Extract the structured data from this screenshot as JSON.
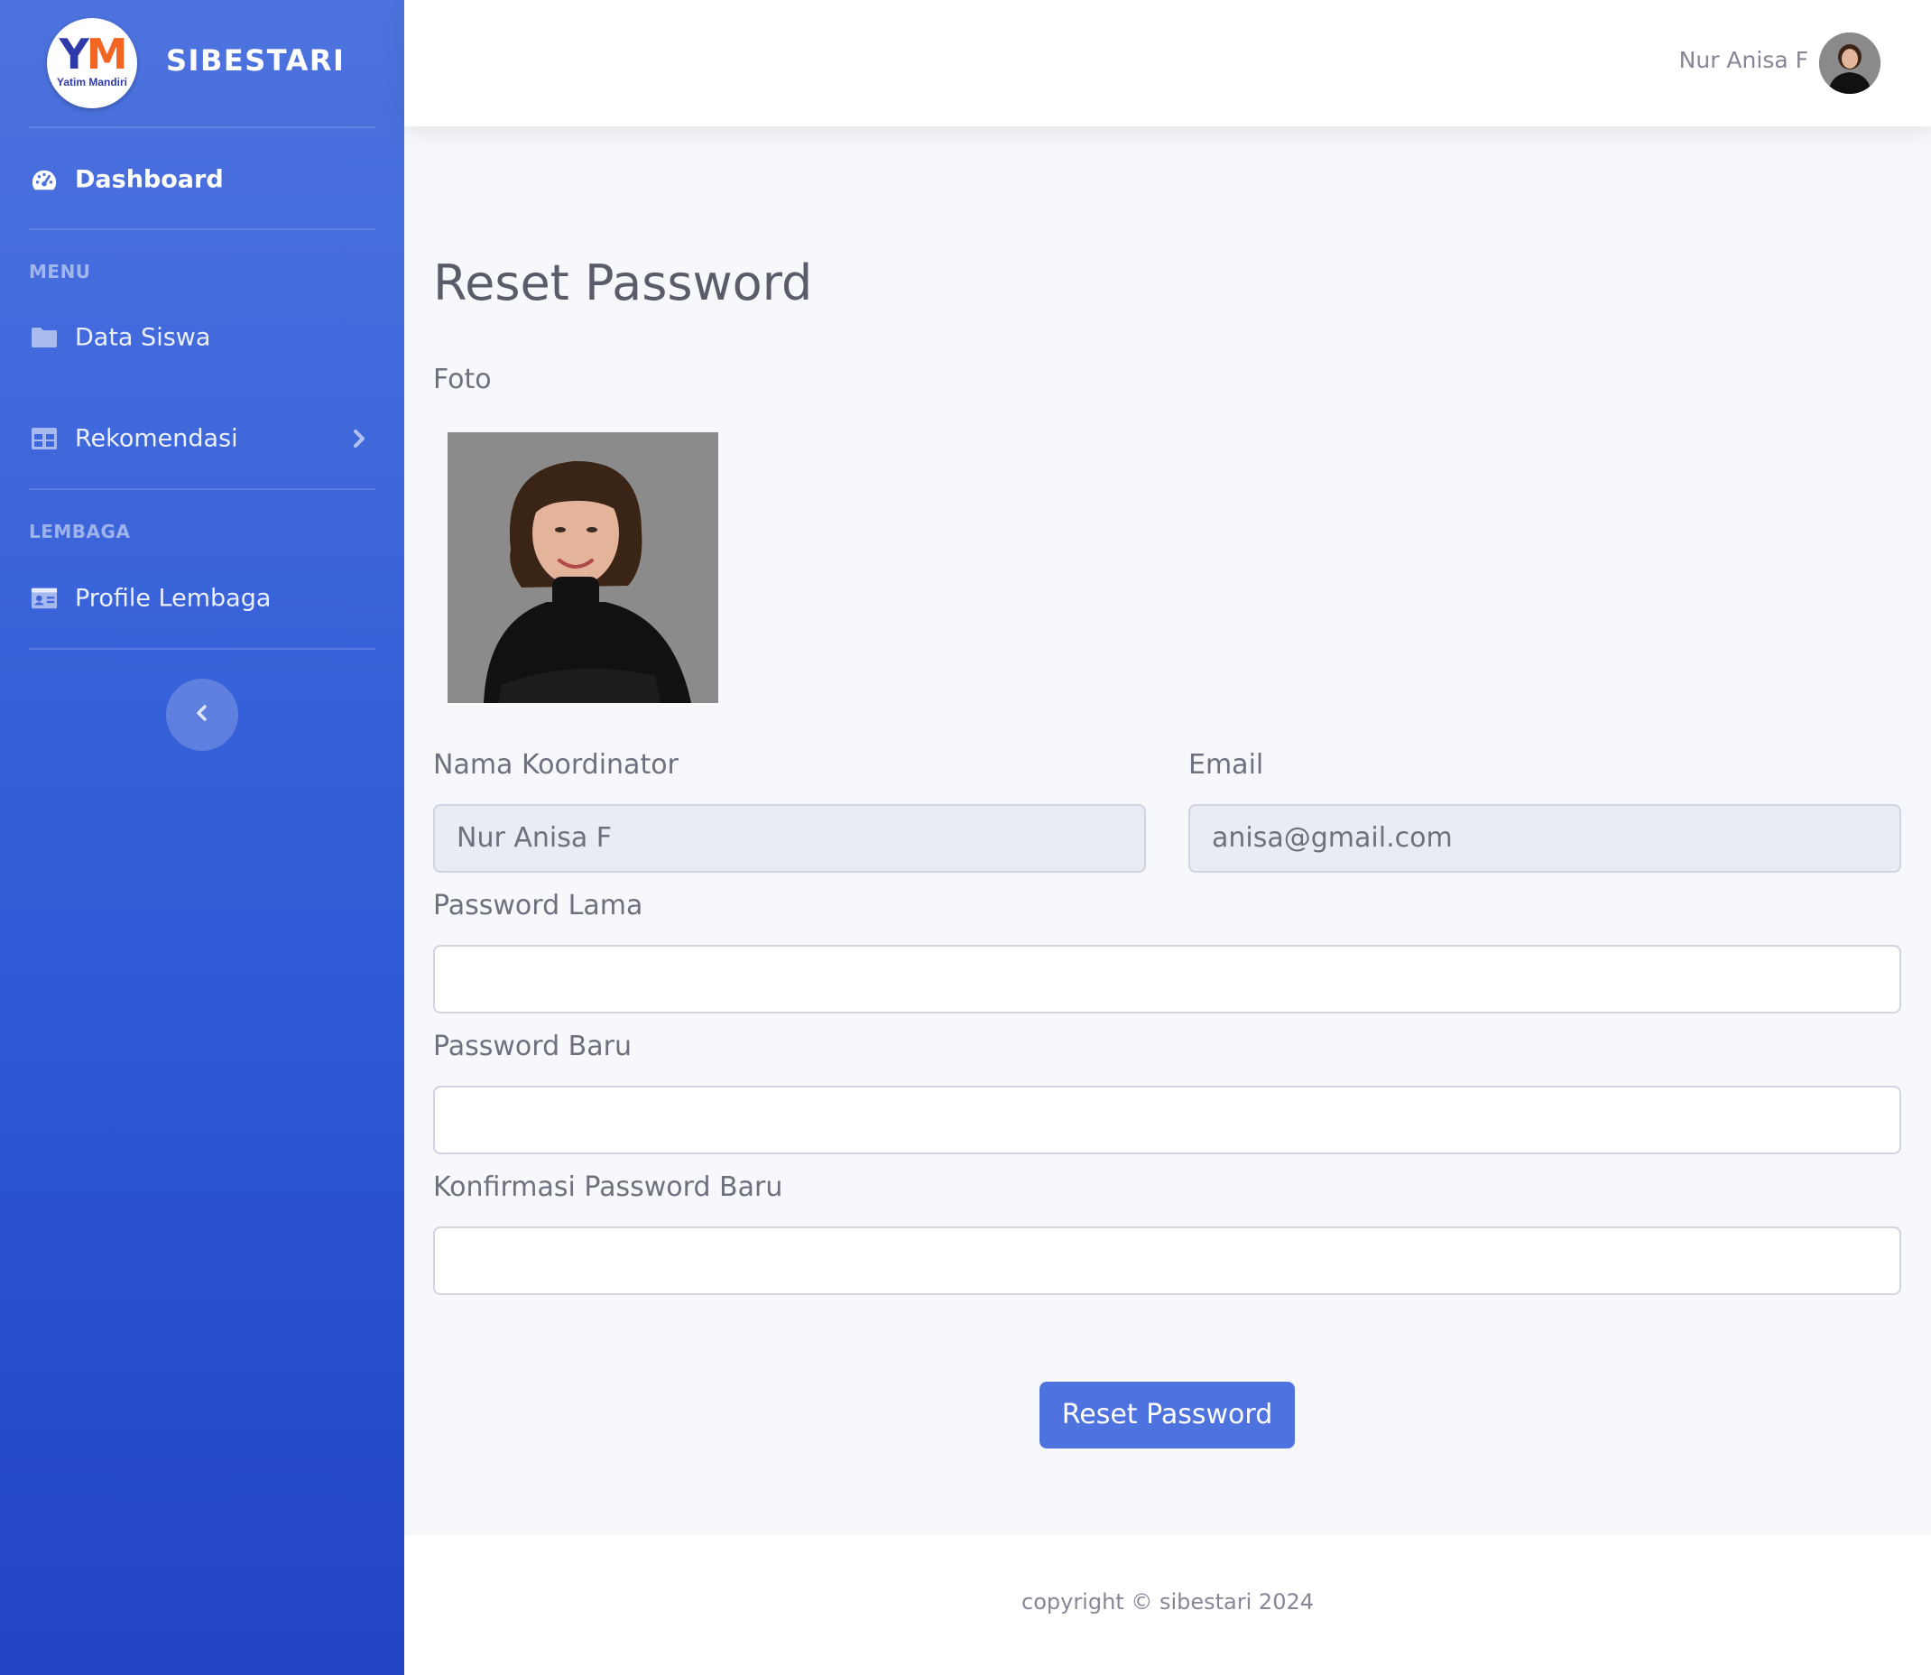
{
  "brand": {
    "logo_letters_y": "Y",
    "logo_letters_m": "M",
    "logo_subtitle": "Yatim Mandiri",
    "name": "SIBESTARI",
    "colors": {
      "primary": "#4e73df",
      "logo_blue": "#2d3aa8",
      "logo_orange": "#f26522"
    }
  },
  "sidebar": {
    "dashboard": {
      "label": "Dashboard",
      "icon": "tachometer-icon"
    },
    "headings": {
      "menu": "MENU",
      "lembaga": "LEMBAGA"
    },
    "items": [
      {
        "label": "Data Siswa",
        "icon": "folder-icon"
      },
      {
        "label": "Rekomendasi",
        "icon": "table-icon"
      },
      {
        "label": "Profile Lembaga",
        "icon": "id-card-icon"
      }
    ],
    "toggle_icon": "chevron-left-icon"
  },
  "topbar": {
    "user_name": "Nur Anisa F"
  },
  "page": {
    "title": "Reset Password",
    "photo_label": "Foto",
    "fields": {
      "name_label": "Nama Koordinator",
      "name_value": "Nur Anisa F",
      "email_label": "Email",
      "email_value": "anisa@gmail.com",
      "old_password_label": "Password Lama",
      "old_password_value": "",
      "new_password_label": "Password Baru",
      "new_password_value": "",
      "confirm_password_label": "Konfirmasi Password Baru",
      "confirm_password_value": ""
    },
    "submit_label": "Reset Password"
  },
  "footer": {
    "copyright": "copyright © sibestari 2024"
  }
}
